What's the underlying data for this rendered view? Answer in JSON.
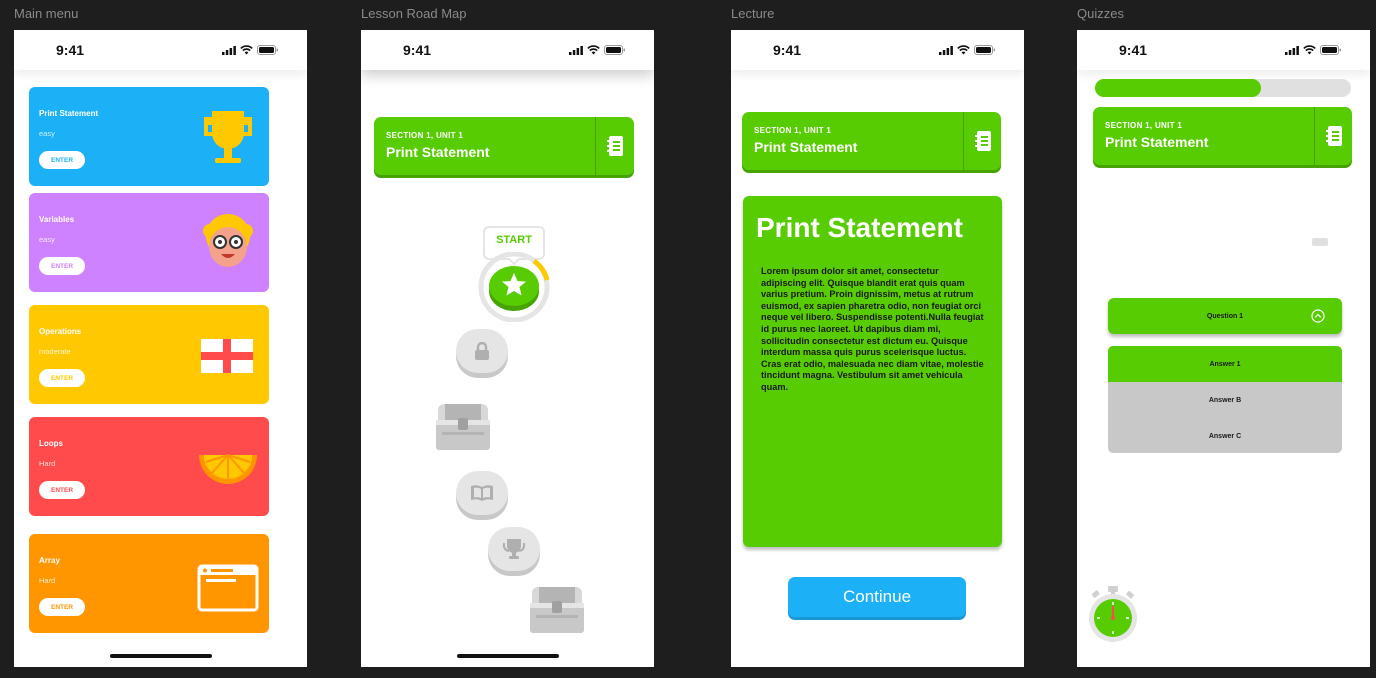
{
  "frames": {
    "menu": "Main menu",
    "roadmap": "Lesson Road Map",
    "lecture": "Lecture",
    "quizzes": "Quizzes"
  },
  "status_time": "9:41",
  "menu_cards": [
    {
      "title": "Print Statement",
      "difficulty": "easy",
      "button": "ENTER",
      "color": "#1cb0f6",
      "icon": "trophy-icon"
    },
    {
      "title": "Variables",
      "difficulty": "easy",
      "button": "ENTER",
      "color": "#ce82ff",
      "icon": "avatar-face-icon"
    },
    {
      "title": "Operations",
      "difficulty": "moderate",
      "button": "ENTER",
      "color": "#ffc800",
      "icon": "flag-cross-icon"
    },
    {
      "title": "Loops",
      "difficulty": "Hard",
      "button": "ENTER",
      "color": "#ff4b4b",
      "icon": "orange-slice-icon"
    },
    {
      "title": "Array",
      "difficulty": "Hard",
      "button": "ENTER",
      "color": "#ff9600",
      "icon": "window-icon"
    }
  ],
  "unit": {
    "section": "SECTION 1, UNIT 1",
    "title": "Print Statement"
  },
  "roadmap": {
    "start_label": "START",
    "nodes": [
      "star-icon",
      "lock-icon",
      "treasure-chest-icon",
      "book-icon",
      "trophy-icon",
      "treasure-chest-icon"
    ]
  },
  "lecture": {
    "title": "Print Statement",
    "body": "Lorem ipsum dolor sit amet, consectetur adipiscing elit. Quisque blandit erat quis quam varius pretium. Proin dignissim, metus at rutrum euismod, ex sapien pharetra odio, non feugiat orci neque vel libero. Suspendisse potenti.Nulla feugiat id purus nec laoreet. Ut dapibus diam mi, sollicitudin consectetur est dictum eu. Quisque interdum massa quis purus scelerisque luctus. Cras erat odio, malesuada nec diam vitae, molestie tincidunt magna. Vestibulum sit amet vehicula quam.",
    "continue_label": "Continue"
  },
  "quiz": {
    "progress_fraction": 0.65,
    "question": "Question 1",
    "answers": [
      "Answer 1",
      "Answer B",
      "Answer C"
    ],
    "selected_answer": 0
  },
  "colors": {
    "green": "#58cc02",
    "blue": "#1cb0f6",
    "background": "#1e1e1e"
  }
}
